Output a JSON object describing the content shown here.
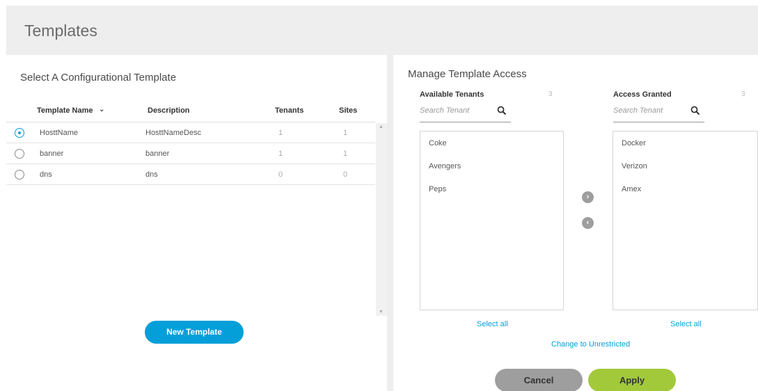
{
  "header": {
    "title": "Templates"
  },
  "left": {
    "title": "Select A Configurational Template",
    "columns": {
      "name": "Template Name",
      "description": "Description",
      "tenants": "Tenants",
      "sites": "Sites"
    },
    "rows": [
      {
        "name": "HosttName",
        "description": "HosttNameDesc",
        "tenants": "1",
        "sites": "1",
        "selected": true
      },
      {
        "name": "banner",
        "description": "banner",
        "tenants": "1",
        "sites": "1",
        "selected": false
      },
      {
        "name": "dns",
        "description": "dns",
        "tenants": "0",
        "sites": "0",
        "selected": false
      }
    ],
    "new_button": "New Template"
  },
  "right": {
    "title": "Manage Template Access",
    "available": {
      "label": "Available Tenants",
      "count": "3",
      "search_placeholder": "Search Tenant",
      "items": [
        "Coke",
        "Avengers",
        "Peps"
      ],
      "select_all": "Select all"
    },
    "granted": {
      "label": "Access Granted",
      "count": "3",
      "search_placeholder": "Search Tenant",
      "items": [
        "Docker",
        "Verizon",
        "Amex"
      ],
      "select_all": "Select all"
    },
    "unrestricted_link": "Change to Unrestricted",
    "cancel": "Cancel",
    "apply": "Apply"
  },
  "colors": {
    "accent": "#049fd9",
    "apply": "#a1c93a",
    "cancel": "#9e9e9e"
  }
}
